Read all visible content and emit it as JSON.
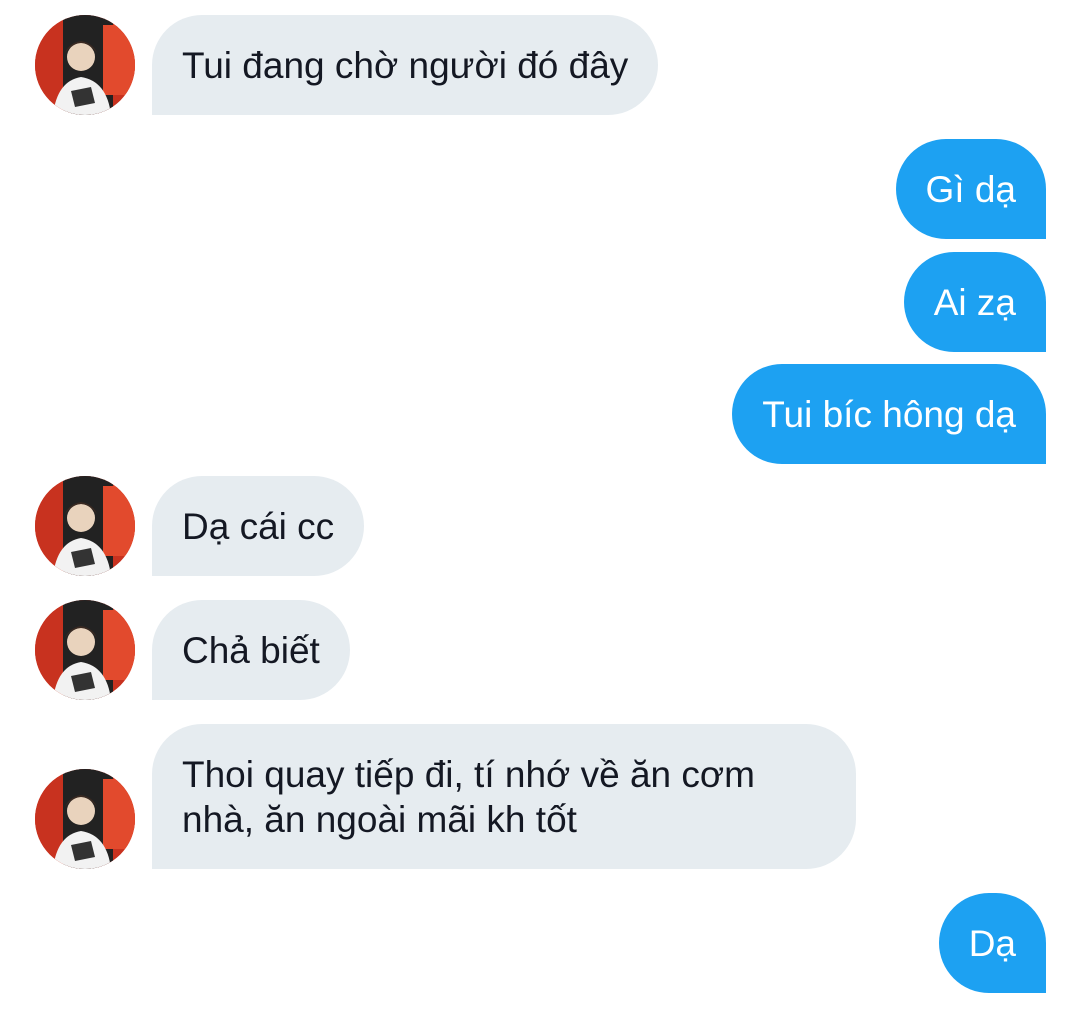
{
  "conversation": {
    "messages": [
      {
        "id": "m1",
        "side": "in",
        "text": "Tui đang chờ người đó đây"
      },
      {
        "id": "m2",
        "side": "out",
        "text": "Gì dạ"
      },
      {
        "id": "m3",
        "side": "out",
        "text": "Ai zạ"
      },
      {
        "id": "m4",
        "side": "out",
        "text": "Tui bíc hông dạ"
      },
      {
        "id": "m5",
        "side": "in",
        "text": "Dạ cái cc"
      },
      {
        "id": "m6",
        "side": "in",
        "text": "Chả biết"
      },
      {
        "id": "m7",
        "side": "in",
        "text": "Thoi quay tiếp đi, tí nhớ về ăn cơm\nnhà, ăn ngoài mãi kh tốt"
      },
      {
        "id": "m8",
        "side": "out",
        "text": "Dạ"
      }
    ]
  },
  "colors": {
    "incoming_bubble": "#e6ecf0",
    "outgoing_bubble": "#1da1f2",
    "incoming_text": "#141823",
    "outgoing_text": "#ffffff",
    "background": "#ffffff"
  },
  "icons": {
    "avatar": "user-avatar-photo"
  }
}
